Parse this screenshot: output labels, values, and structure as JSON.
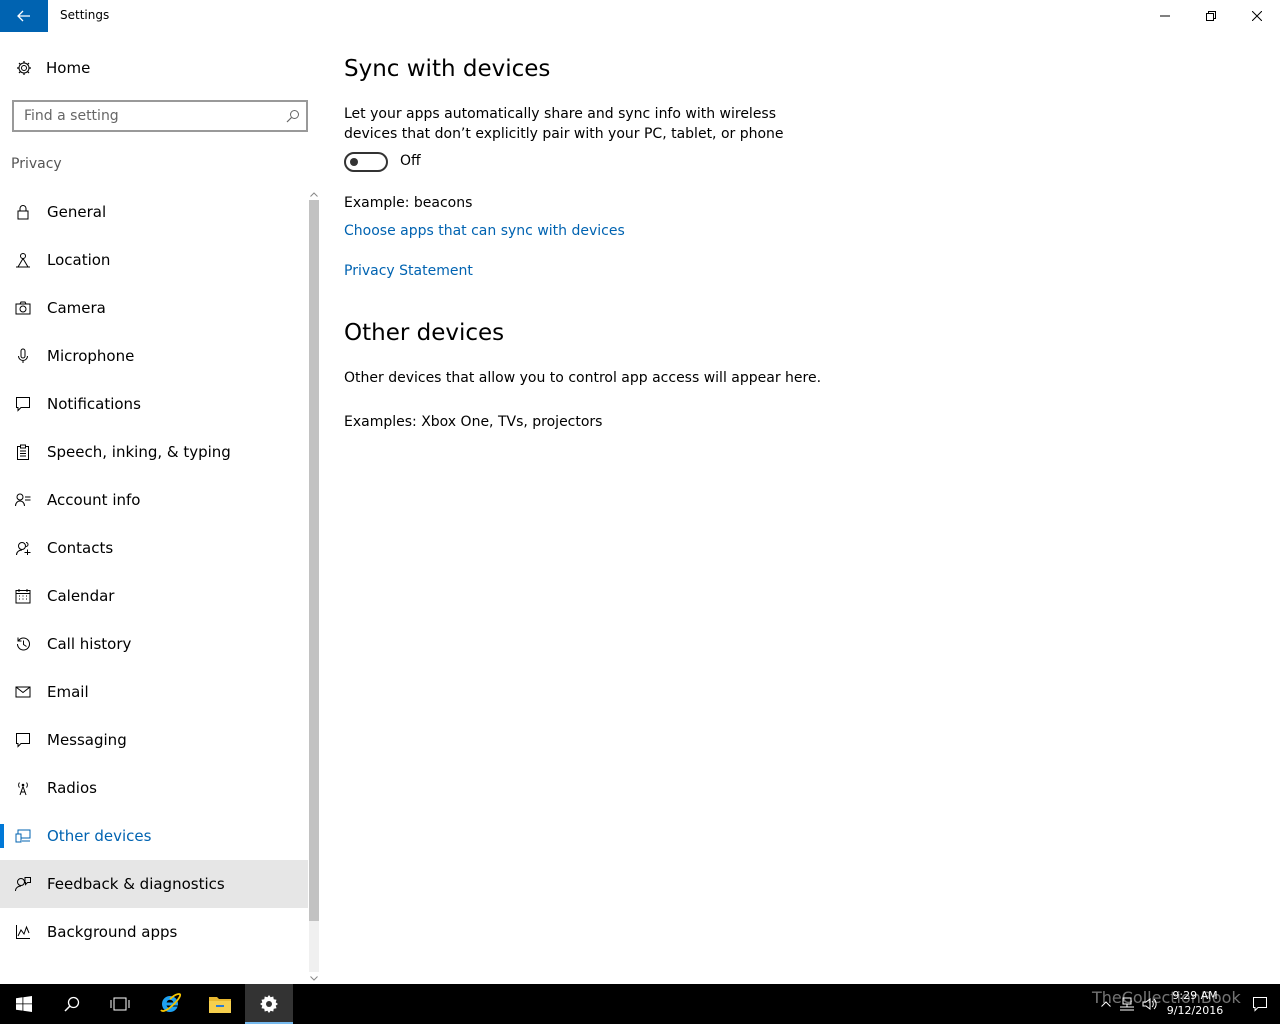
{
  "window": {
    "title": "Settings"
  },
  "sidebar": {
    "home_label": "Home",
    "search_placeholder": "Find a setting",
    "section_title": "Privacy",
    "items": [
      {
        "label": "General",
        "icon": "lock-icon"
      },
      {
        "label": "Location",
        "icon": "location-icon"
      },
      {
        "label": "Camera",
        "icon": "camera-icon"
      },
      {
        "label": "Microphone",
        "icon": "microphone-icon"
      },
      {
        "label": "Notifications",
        "icon": "notifications-icon"
      },
      {
        "label": "Speech, inking, & typing",
        "icon": "clipboard-icon"
      },
      {
        "label": "Account info",
        "icon": "account-icon"
      },
      {
        "label": "Contacts",
        "icon": "contacts-icon"
      },
      {
        "label": "Calendar",
        "icon": "calendar-icon"
      },
      {
        "label": "Call history",
        "icon": "history-icon"
      },
      {
        "label": "Email",
        "icon": "email-icon"
      },
      {
        "label": "Messaging",
        "icon": "messaging-icon"
      },
      {
        "label": "Radios",
        "icon": "radio-tower-icon"
      },
      {
        "label": "Other devices",
        "icon": "devices-icon",
        "selected": true
      },
      {
        "label": "Feedback & diagnostics",
        "icon": "feedback-icon",
        "hover": true
      },
      {
        "label": "Background apps",
        "icon": "chart-icon"
      }
    ]
  },
  "main": {
    "sync_heading": "Sync with devices",
    "sync_desc_line1": "Let your apps automatically share and sync info with wireless",
    "sync_desc_line2": "devices that don’t explicitly pair with your PC, tablet, or phone",
    "toggle_state": "Off",
    "example_text": "Example: beacons",
    "choose_apps_link": "Choose apps that can sync with devices",
    "privacy_link": "Privacy Statement",
    "other_heading": "Other devices",
    "other_desc": "Other devices that allow you to control app access will appear here.",
    "other_examples": "Examples: Xbox One, TVs, projectors"
  },
  "taskbar": {
    "time": "9:29 AM",
    "date": "9/12/2016",
    "watermark": "TheCollectionBook"
  },
  "colors": {
    "accent": "#0078d7",
    "link": "#0063b1"
  }
}
